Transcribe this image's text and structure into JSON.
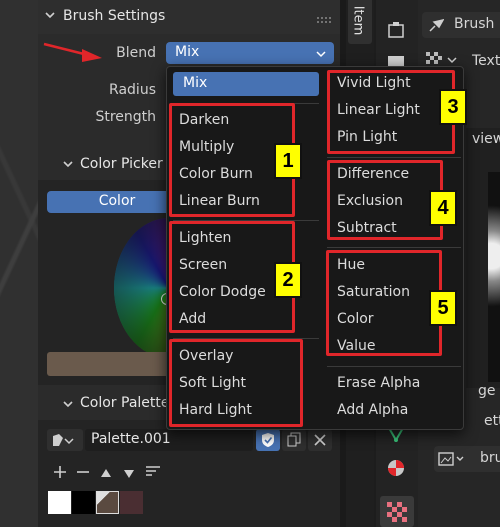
{
  "panel": {
    "header_title": "Brush Settings",
    "blend_label": "Blend",
    "blend_value": "Mix",
    "radius_label": "Radius",
    "strength_label": "Strength",
    "color_picker_title": "Color Picker",
    "color_tab": "Color",
    "color_palette_title": "Color Palette",
    "palette_name": "Palette.001"
  },
  "right": {
    "tab_item": "Item",
    "brush_label": "Brush M",
    "text_label": "Text",
    "review_fragment": "view",
    "ge_fragment": "ge",
    "setting_fragment": "ettin",
    "bru_fragment": "bru"
  },
  "menu": {
    "left_column": [
      {
        "label": "Mix",
        "selected": true
      },
      {
        "label": "Darken"
      },
      {
        "label": "Multiply"
      },
      {
        "label": "Color Burn"
      },
      {
        "label": "Linear Burn"
      },
      {
        "label": "Lighten"
      },
      {
        "label": "Screen"
      },
      {
        "label": "Color Dodge"
      },
      {
        "label": "Add"
      },
      {
        "label": "Overlay"
      },
      {
        "label": "Soft Light"
      },
      {
        "label": "Hard Light"
      }
    ],
    "right_column": [
      {
        "label": "Vivid Light"
      },
      {
        "label": "Linear Light"
      },
      {
        "label": "Pin Light"
      },
      {
        "label": "Difference"
      },
      {
        "label": "Exclusion"
      },
      {
        "label": "Subtract"
      },
      {
        "label": "Hue"
      },
      {
        "label": "Saturation"
      },
      {
        "label": "Color"
      },
      {
        "label": "Value"
      },
      {
        "label": "Erase Alpha"
      },
      {
        "label": "Add Alpha"
      }
    ]
  },
  "annotations": {
    "badges": [
      "1",
      "2",
      "3",
      "4",
      "5"
    ]
  },
  "colors": {
    "selection": "#4772b3",
    "annotation_red": "#e0262a",
    "badge_yellow": "#ffff00",
    "panel_bg": "#2b2b2b",
    "menu_bg": "#181818"
  },
  "icons": [
    "drag-handle-icon",
    "chevron-down-icon",
    "brush-icon",
    "palette-icon",
    "fake-user-shield-icon",
    "duplicate-icon",
    "close-icon",
    "add-icon",
    "remove-icon",
    "move-up-icon",
    "move-down-icon",
    "sort-icon",
    "red-arrow-icon",
    "tool-icon",
    "texture-icon",
    "image-icon",
    "transform-icon",
    "color-icon",
    "checker-icon"
  ]
}
